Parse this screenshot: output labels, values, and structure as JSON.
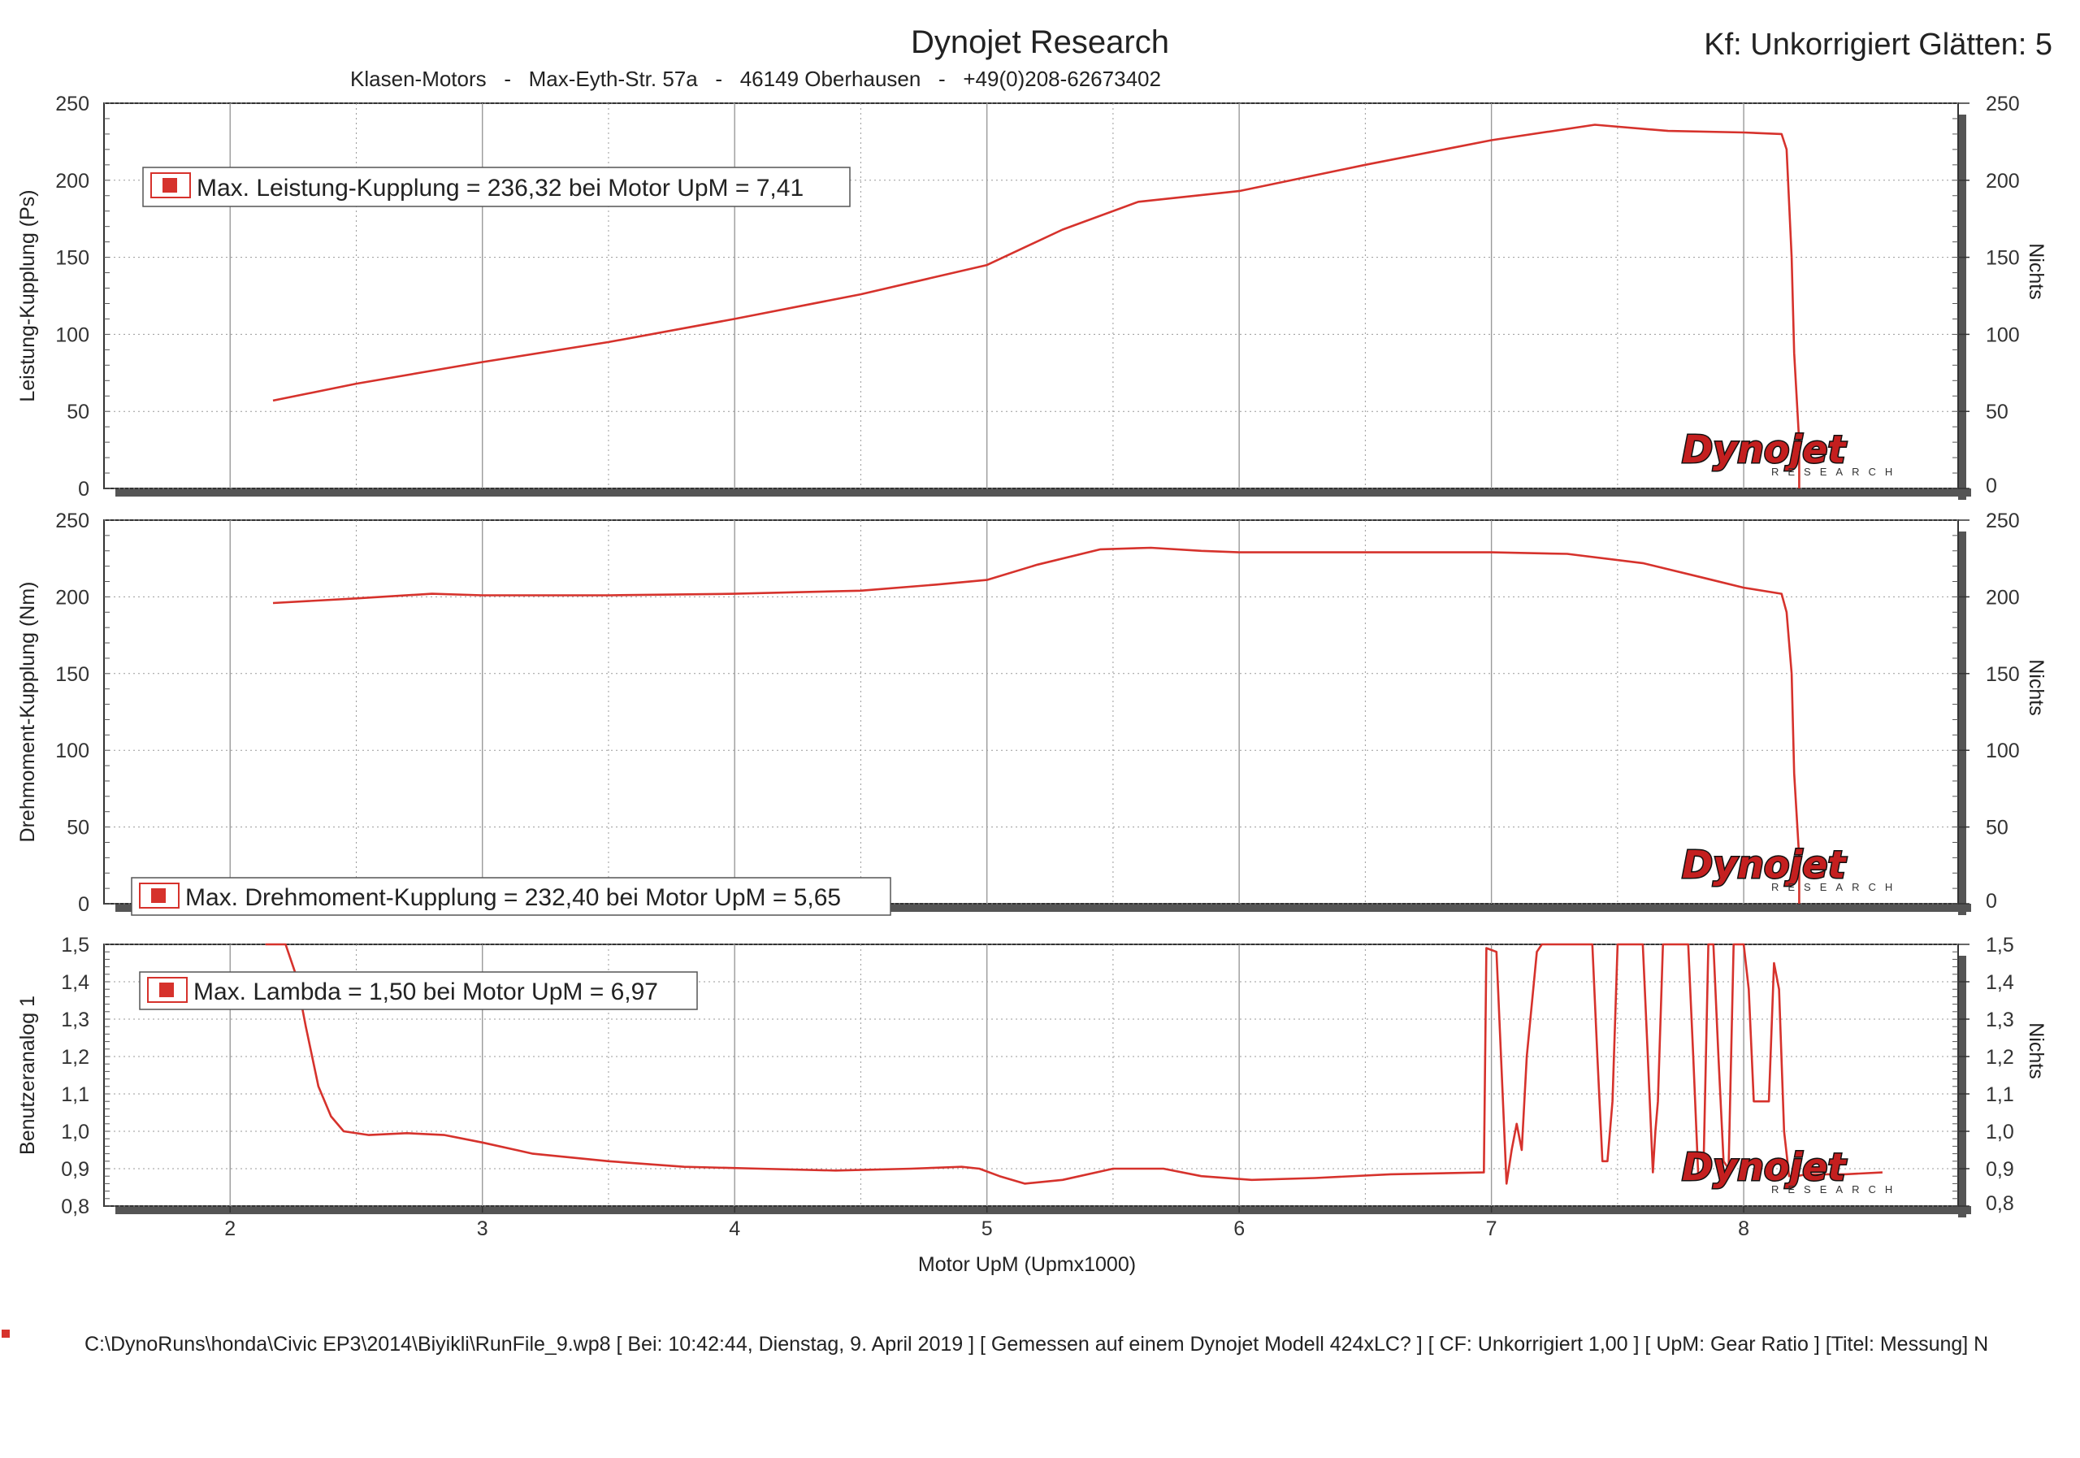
{
  "header": {
    "title": "Dynojet Research",
    "subtitle": "Klasen-Motors   -   Max-Eyth-Str. 57a   -   46149 Oberhausen   -   +49(0)208-62673402",
    "correction": "Kf: Unkorrigiert Glätten: 5"
  },
  "footer": {
    "text": "C:\\DynoRuns\\honda\\Civic EP3\\2014\\Biyikli\\RunFile_9.wp8 [ Bei: 10:42:44, Dienstag, 9. April 2019 ] [ Gemessen auf einem Dynojet Modell 424xLC? ] [ CF: Unkorrigiert 1,00 ] [ UpM: Gear Ratio ] [Titel: Messung]  N"
  },
  "logo": {
    "brand": "Dynojet",
    "sub": "RESEARCH"
  },
  "colors": {
    "series": "#d6322c",
    "grid": "#9a9a9a",
    "frame": "#333333"
  },
  "chart_data": [
    {
      "type": "line",
      "ylabel": "Leistung-Kupplung (Ps)",
      "ylabel_right": "Nichts",
      "xlim": [
        1.5,
        8.85
      ],
      "ylim": [
        0,
        250
      ],
      "yticks": [
        "0",
        "50",
        "100",
        "150",
        "200",
        "250"
      ],
      "legend": "Max. Leistung-Kupplung = 236,32 bei Motor UpM = 7,41",
      "legend_position": "top-left",
      "series": [
        {
          "x": [
            2.17,
            2.5,
            3.0,
            3.5,
            4.0,
            4.5,
            5.0,
            5.3,
            5.6,
            6.0,
            6.5,
            7.0,
            7.41,
            7.7,
            8.0,
            8.15,
            8.17,
            8.19,
            8.2,
            8.22,
            8.22
          ],
          "y": [
            57,
            68,
            82,
            95,
            110,
            126,
            145,
            168,
            186,
            193,
            210,
            226,
            236,
            232,
            231,
            230,
            220,
            150,
            88,
            30,
            0
          ]
        }
      ]
    },
    {
      "type": "line",
      "ylabel": "Drehmoment-Kupplung (Nm)",
      "ylabel_right": "Nichts",
      "xlim": [
        1.5,
        8.85
      ],
      "ylim": [
        0,
        250
      ],
      "yticks": [
        "0",
        "50",
        "100",
        "150",
        "200",
        "250"
      ],
      "legend": "Max. Drehmoment-Kupplung = 232,40 bei Motor UpM = 5,65",
      "legend_position": "bottom-left",
      "series": [
        {
          "x": [
            2.17,
            2.5,
            2.8,
            3.0,
            3.5,
            4.0,
            4.5,
            4.8,
            5.0,
            5.2,
            5.45,
            5.65,
            5.85,
            6.0,
            6.5,
            7.0,
            7.3,
            7.6,
            7.85,
            8.0,
            8.15,
            8.17,
            8.19,
            8.2,
            8.22,
            8.22
          ],
          "y": [
            196,
            199,
            202,
            201,
            201,
            202,
            204,
            208,
            211,
            221,
            231,
            232,
            230,
            229,
            229,
            229,
            228,
            222,
            212,
            206,
            202,
            190,
            150,
            85,
            30,
            0
          ]
        }
      ]
    },
    {
      "type": "line",
      "ylabel": "Benutzeranalog 1",
      "ylabel_right": "Nichts",
      "xlabel": "Motor UpM (Upmx1000)",
      "xlim": [
        1.5,
        8.85
      ],
      "ylim": [
        0.8,
        1.5
      ],
      "xticks": [
        "2",
        "3",
        "4",
        "5",
        "6",
        "7",
        "8"
      ],
      "yticks": [
        "0,8",
        "0,9",
        "1,0",
        "1,1",
        "1,2",
        "1,3",
        "1,4",
        "1,5"
      ],
      "legend": "Max. Lambda = 1,50 bei Motor UpM = 6,97",
      "legend_position": "top-left",
      "series": [
        {
          "x": [
            2.14,
            2.22,
            2.26,
            2.3,
            2.35,
            2.4,
            2.45,
            2.55,
            2.7,
            2.85,
            3.0,
            3.2,
            3.5,
            3.8,
            4.1,
            4.4,
            4.7,
            4.9,
            4.97,
            5.05,
            5.15,
            5.3,
            5.5,
            5.7,
            5.85,
            6.05,
            6.3,
            6.6,
            6.97,
            6.98,
            7.02,
            7.06,
            7.08,
            7.1,
            7.12,
            7.14,
            7.18,
            7.2,
            7.25,
            7.4,
            7.42,
            7.44,
            7.46,
            7.48,
            7.5,
            7.52,
            7.6,
            7.62,
            7.64,
            7.65,
            7.66,
            7.68,
            7.7,
            7.78,
            7.8,
            7.82,
            7.84,
            7.86,
            7.88,
            7.9,
            7.92,
            7.94,
            7.96,
            8.0,
            8.02,
            8.04,
            8.06,
            8.08,
            8.1,
            8.12,
            8.14,
            8.16,
            8.18,
            8.2,
            8.21,
            8.25,
            8.4,
            8.55
          ],
          "y": [
            1.5,
            1.5,
            1.42,
            1.28,
            1.12,
            1.04,
            1.0,
            0.99,
            0.995,
            0.99,
            0.97,
            0.94,
            0.92,
            0.905,
            0.9,
            0.895,
            0.9,
            0.905,
            0.9,
            0.88,
            0.86,
            0.87,
            0.9,
            0.9,
            0.88,
            0.87,
            0.875,
            0.885,
            0.89,
            1.49,
            1.48,
            0.86,
            0.95,
            1.02,
            0.95,
            1.2,
            1.48,
            1.5,
            1.5,
            1.5,
            1.2,
            0.92,
            0.92,
            1.08,
            1.5,
            1.5,
            1.5,
            1.2,
            0.89,
            1.0,
            1.08,
            1.5,
            1.5,
            1.5,
            1.2,
            0.88,
            0.88,
            1.5,
            1.5,
            1.2,
            0.92,
            0.9,
            1.5,
            1.5,
            1.38,
            1.08,
            1.08,
            1.08,
            1.08,
            1.45,
            1.38,
            1.0,
            0.88,
            0.88,
            0.88,
            0.885,
            0.885,
            0.89
          ]
        }
      ]
    }
  ]
}
